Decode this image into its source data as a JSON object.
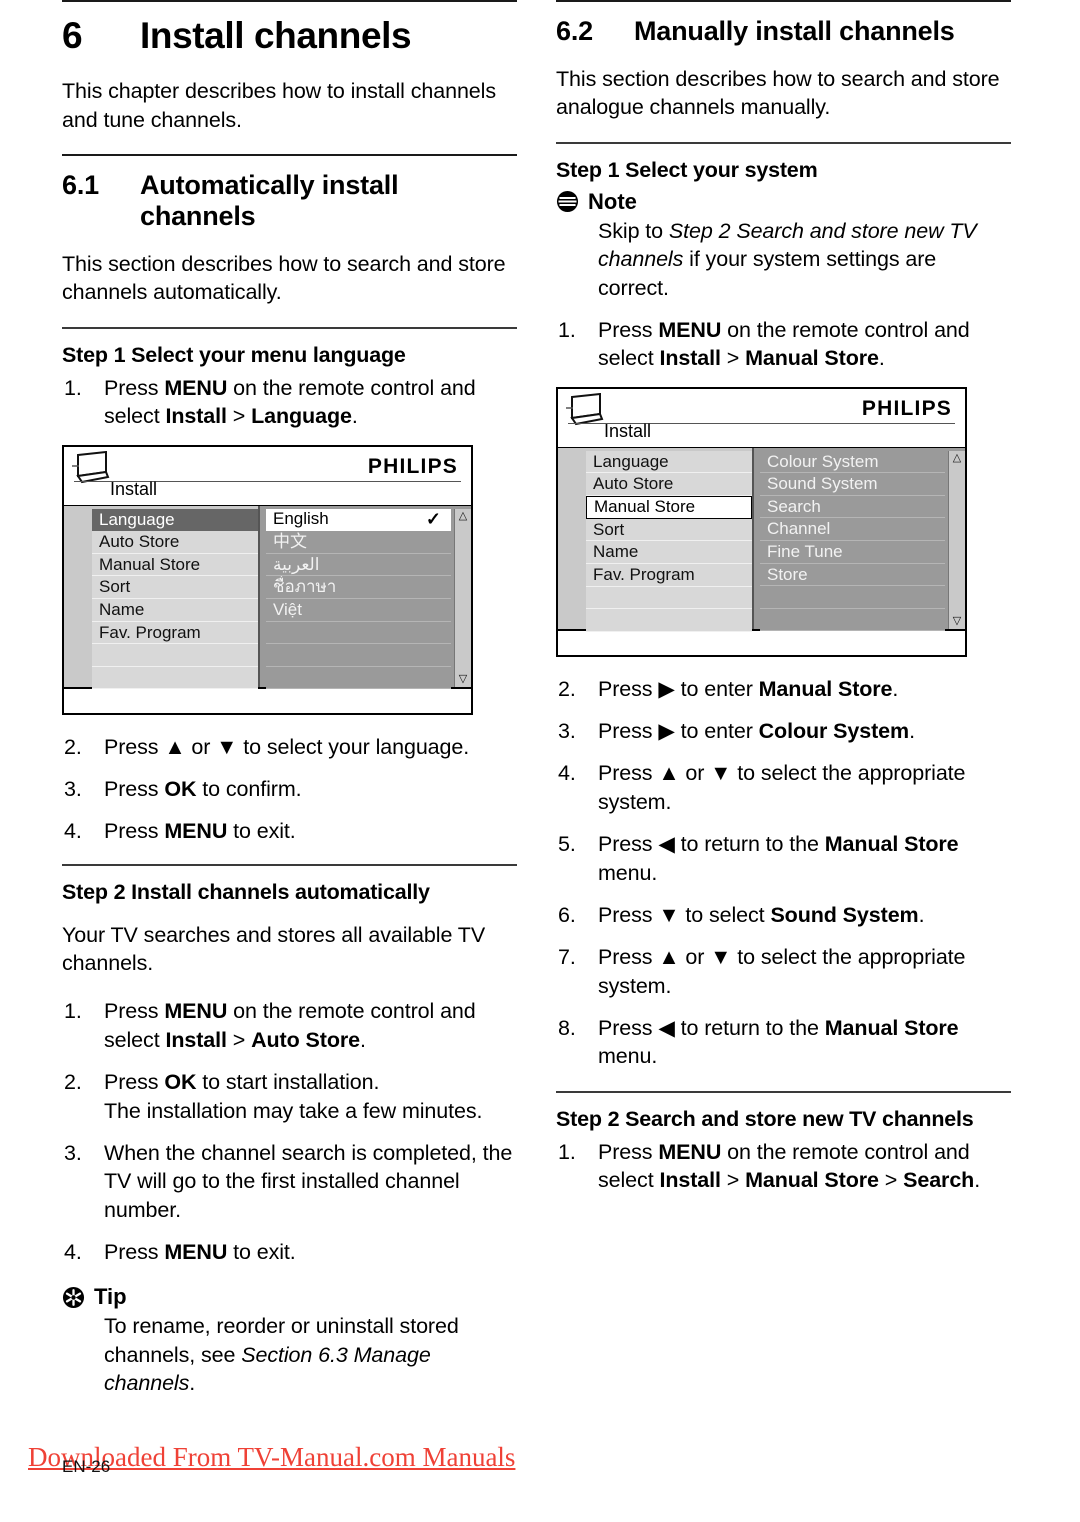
{
  "chapter": {
    "number": "6",
    "title": "Install channels",
    "intro": "This chapter describes how to install channels and tune channels."
  },
  "section_61": {
    "number": "6.1",
    "title": "Automatically install channels",
    "intro": "This section describes how to search and store channels automatically.",
    "step1_heading": "Step 1 Select your menu language",
    "step1_items": [
      {
        "marker": "1.",
        "html": "Press <b>MENU</b> on the remote control and select <b>Install</b> &gt; <b>Language</b>."
      },
      {
        "marker": "2.",
        "html": "Press ▲ or ▼ to select your language."
      },
      {
        "marker": "3.",
        "html": "Press <b>OK</b> to confirm."
      },
      {
        "marker": "4.",
        "html": "Press <b>MENU</b> to exit."
      }
    ],
    "step2_heading": "Step 2 Install channels automatically",
    "step2_intro": "Your TV searches and stores all available TV channels.",
    "step2_items": [
      {
        "marker": "1.",
        "html": "Press <b>MENU</b> on the remote control and select <b>Install</b> &gt; <b>Auto Store</b>."
      },
      {
        "marker": "2.",
        "html": "Press <b>OK</b> to start installation.<br>The installation may take a few minutes."
      },
      {
        "marker": "3.",
        "html": "When the channel search is completed, the TV will go to the first installed channel number."
      },
      {
        "marker": "4.",
        "html": "Press <b>MENU</b> to exit."
      }
    ],
    "tip": {
      "icon": "tip-asterisk-icon",
      "label": "Tip",
      "html": "To rename, reorder or uninstall stored channels, see <i>Section 6.3 Manage channels</i>."
    }
  },
  "section_62": {
    "number": "6.2",
    "title": "Manually install channels",
    "intro": "This section describes how to search and store analogue channels manually.",
    "step1_heading": "Step 1 Select your system",
    "note": {
      "icon": "note-lines-icon",
      "label": "Note",
      "html": "Skip to <i>Step 2 Search and store new TV channels</i> if your system settings are correct."
    },
    "step1_items_before_osd": [
      {
        "marker": "1.",
        "html": "Press <b>MENU</b> on the remote control and select <b>Install</b> &gt; <b>Manual Store</b>."
      }
    ],
    "step1_items_after_osd": [
      {
        "marker": "2.",
        "html": "Press ▶ to enter <b>Manual Store</b>."
      },
      {
        "marker": "3.",
        "html": "Press ▶ to enter <b>Colour System</b>."
      },
      {
        "marker": "4.",
        "html": "Press ▲ or ▼ to select the appropriate system."
      },
      {
        "marker": "5.",
        "html": "Press ◀ to return to the <b>Manual Store</b> menu."
      },
      {
        "marker": "6.",
        "html": "Press ▼ to select <b>Sound System</b>."
      },
      {
        "marker": "7.",
        "html": "Press ▲ or ▼ to select the appropriate system."
      },
      {
        "marker": "8.",
        "html": "Press ◀ to return to the <b>Manual Store</b> menu."
      }
    ],
    "step2_heading": "Step 2 Search and store new TV channels",
    "step2_items": [
      {
        "marker": "1.",
        "html": "Press <b>MENU</b> on the remote control and select <b>Install</b> &gt; <b>Manual Store</b> &gt; <b>Search</b>."
      }
    ]
  },
  "osd_language": {
    "brand": "PHILIPS",
    "breadcrumb": "Install",
    "tv_icon": "tv-monitor-icon",
    "left_items": [
      {
        "label": "Language",
        "state": "selected-dark"
      },
      {
        "label": "Auto Store",
        "state": "normal"
      },
      {
        "label": "Manual Store",
        "state": "normal"
      },
      {
        "label": "Sort",
        "state": "normal"
      },
      {
        "label": "Name",
        "state": "normal"
      },
      {
        "label": "Fav. Program",
        "state": "normal"
      },
      {
        "label": "",
        "state": "blank"
      },
      {
        "label": "",
        "state": "blank"
      }
    ],
    "right_items": [
      {
        "label": "English",
        "state": "selected-white",
        "check": "✓"
      },
      {
        "label": "中文",
        "state": "normal",
        "check": ""
      },
      {
        "label": "العربية",
        "state": "normal",
        "check": ""
      },
      {
        "label": "ชื่อภาษา",
        "state": "normal",
        "check": ""
      },
      {
        "label": "Việt",
        "state": "normal",
        "check": ""
      },
      {
        "label": "",
        "state": "blank",
        "check": ""
      },
      {
        "label": "",
        "state": "blank",
        "check": ""
      },
      {
        "label": "",
        "state": "blank",
        "check": ""
      }
    ],
    "scroll_up": "△",
    "scroll_down": "▽"
  },
  "osd_manual_store": {
    "brand": "PHILIPS",
    "breadcrumb": "Install",
    "tv_icon": "tv-monitor-icon",
    "left_items": [
      {
        "label": "Language",
        "state": "normal"
      },
      {
        "label": "Auto Store",
        "state": "normal"
      },
      {
        "label": "Manual Store",
        "state": "selected-white"
      },
      {
        "label": "Sort",
        "state": "normal"
      },
      {
        "label": "Name",
        "state": "normal"
      },
      {
        "label": "Fav. Program",
        "state": "normal"
      },
      {
        "label": "",
        "state": "blank"
      },
      {
        "label": "",
        "state": "blank"
      }
    ],
    "right_items": [
      {
        "label": "Colour System",
        "state": "normal",
        "check": ""
      },
      {
        "label": "Sound System",
        "state": "normal",
        "check": ""
      },
      {
        "label": "Search",
        "state": "normal",
        "check": ""
      },
      {
        "label": "Channel",
        "state": "normal",
        "check": ""
      },
      {
        "label": "Fine Tune",
        "state": "normal",
        "check": ""
      },
      {
        "label": "Store",
        "state": "normal",
        "check": ""
      },
      {
        "label": "",
        "state": "blank",
        "check": ""
      },
      {
        "label": "",
        "state": "blank",
        "check": ""
      }
    ],
    "scroll_up": "△",
    "scroll_down": "▽"
  },
  "footer": {
    "page_label": "EN-26",
    "watermark": "Downloaded From TV-Manual.com Manuals",
    "watermark_color": "#ef4136"
  }
}
